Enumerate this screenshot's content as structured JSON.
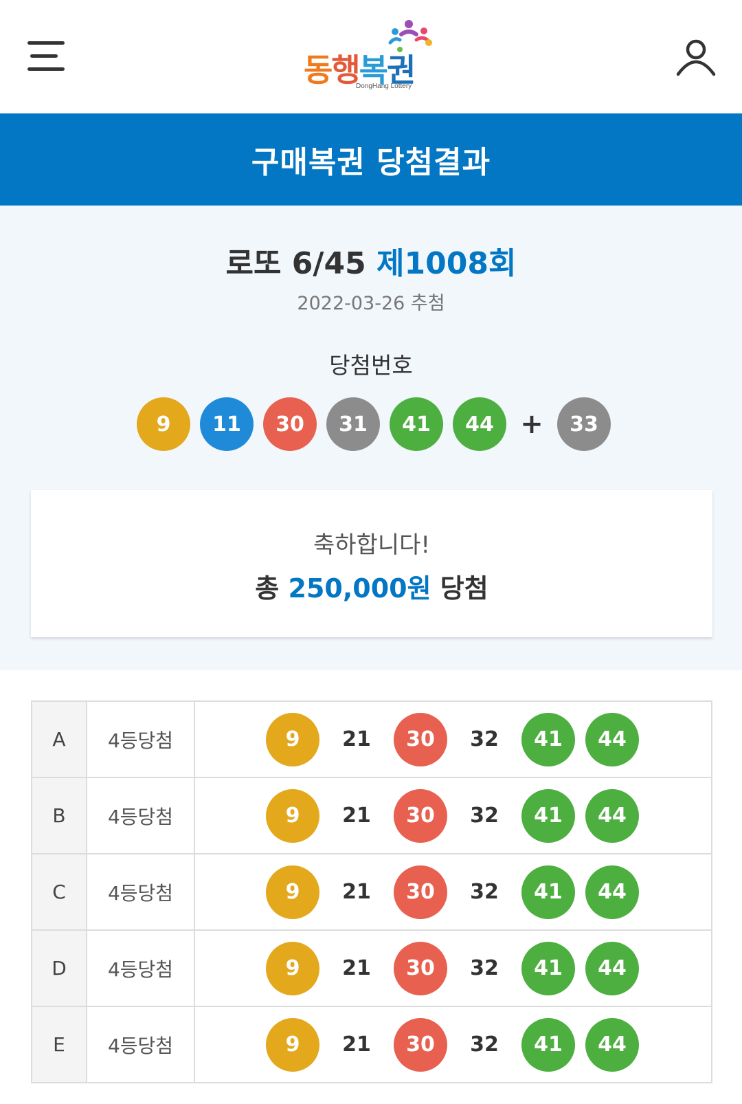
{
  "header": {
    "menu_icon": "hamburger-menu-icon",
    "logo": {
      "text_parts": [
        "동",
        "행",
        "복",
        "권"
      ],
      "subtitle": "DongHang Lottery"
    },
    "user_icon": "user-icon"
  },
  "page_title": "구매복권 당첨결과",
  "draw": {
    "game": "로또 6/45",
    "round": "제1008회",
    "date": "2022-03-26 추첨",
    "numbers_label": "당첨번호",
    "numbers": [
      {
        "n": "9",
        "color": "#e3a81c"
      },
      {
        "n": "11",
        "color": "#1f8ad8"
      },
      {
        "n": "30",
        "color": "#e8604f"
      },
      {
        "n": "31",
        "color": "#8c8c8c"
      },
      {
        "n": "41",
        "color": "#4caf3f"
      },
      {
        "n": "44",
        "color": "#4caf3f"
      }
    ],
    "plus": "+",
    "bonus": {
      "n": "33",
      "color": "#8c8c8c"
    }
  },
  "congrats": {
    "message": "축하합니다!",
    "prefix": "총",
    "amount": "250,000원",
    "suffix": "당첨"
  },
  "tickets": [
    {
      "line": "A",
      "rank": "4등당첨",
      "nums": [
        {
          "n": "9",
          "match": true,
          "color": "#e3a81c"
        },
        {
          "n": "21",
          "match": false
        },
        {
          "n": "30",
          "match": true,
          "color": "#e8604f"
        },
        {
          "n": "32",
          "match": false
        },
        {
          "n": "41",
          "match": true,
          "color": "#4caf3f"
        },
        {
          "n": "44",
          "match": true,
          "color": "#4caf3f"
        }
      ]
    },
    {
      "line": "B",
      "rank": "4등당첨",
      "nums": [
        {
          "n": "9",
          "match": true,
          "color": "#e3a81c"
        },
        {
          "n": "21",
          "match": false
        },
        {
          "n": "30",
          "match": true,
          "color": "#e8604f"
        },
        {
          "n": "32",
          "match": false
        },
        {
          "n": "41",
          "match": true,
          "color": "#4caf3f"
        },
        {
          "n": "44",
          "match": true,
          "color": "#4caf3f"
        }
      ]
    },
    {
      "line": "C",
      "rank": "4등당첨",
      "nums": [
        {
          "n": "9",
          "match": true,
          "color": "#e3a81c"
        },
        {
          "n": "21",
          "match": false
        },
        {
          "n": "30",
          "match": true,
          "color": "#e8604f"
        },
        {
          "n": "32",
          "match": false
        },
        {
          "n": "41",
          "match": true,
          "color": "#4caf3f"
        },
        {
          "n": "44",
          "match": true,
          "color": "#4caf3f"
        }
      ]
    },
    {
      "line": "D",
      "rank": "4등당첨",
      "nums": [
        {
          "n": "9",
          "match": true,
          "color": "#e3a81c"
        },
        {
          "n": "21",
          "match": false
        },
        {
          "n": "30",
          "match": true,
          "color": "#e8604f"
        },
        {
          "n": "32",
          "match": false
        },
        {
          "n": "41",
          "match": true,
          "color": "#4caf3f"
        },
        {
          "n": "44",
          "match": true,
          "color": "#4caf3f"
        }
      ]
    },
    {
      "line": "E",
      "rank": "4등당첨",
      "nums": [
        {
          "n": "9",
          "match": true,
          "color": "#e3a81c"
        },
        {
          "n": "21",
          "match": false
        },
        {
          "n": "30",
          "match": true,
          "color": "#e8604f"
        },
        {
          "n": "32",
          "match": false
        },
        {
          "n": "41",
          "match": true,
          "color": "#4caf3f"
        },
        {
          "n": "44",
          "match": true,
          "color": "#4caf3f"
        }
      ]
    }
  ]
}
